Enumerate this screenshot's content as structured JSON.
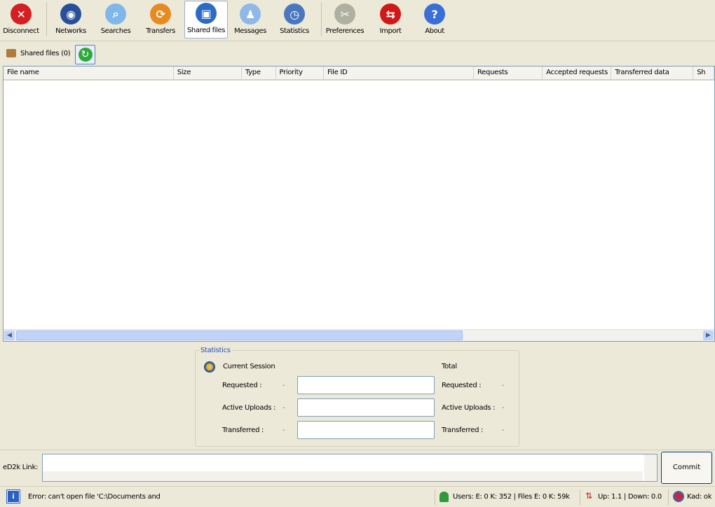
{
  "toolbar": [
    {
      "label": "Disconnect",
      "icon": "disconnect-icon"
    },
    {
      "label": "Networks",
      "icon": "networks-icon"
    },
    {
      "label": "Searches",
      "icon": "searches-icon"
    },
    {
      "label": "Transfers",
      "icon": "transfers-icon"
    },
    {
      "label": "Shared files",
      "icon": "shared-files-icon"
    },
    {
      "label": "Messages",
      "icon": "messages-icon"
    },
    {
      "label": "Statistics",
      "icon": "statistics-icon"
    },
    {
      "label": "Preferences",
      "icon": "preferences-icon"
    },
    {
      "label": "Import",
      "icon": "import-icon"
    },
    {
      "label": "About",
      "icon": "about-icon"
    }
  ],
  "shared_label": "Shared files (0)",
  "columns": [
    "File name",
    "Size",
    "Type",
    "Priority",
    "File ID",
    "Requests",
    "Accepted requests",
    "Transferred data",
    "Sh"
  ],
  "stats": {
    "title": "Statistics",
    "current": "Current Session",
    "total": "Total",
    "rows": [
      {
        "label": "Requested :",
        "value": "-",
        "total_label": "Requested :",
        "total_value": "-"
      },
      {
        "label": "Active Uploads :",
        "value": "-",
        "total_label": "Active Uploads :",
        "total_value": "-"
      },
      {
        "label": "Transferred :",
        "value": "-",
        "total_label": "Transferred :",
        "total_value": "-"
      }
    ]
  },
  "ed2k": {
    "label": "eD2k Link:",
    "value": "",
    "commit": "Commit"
  },
  "status": {
    "message": "Error: can't open file 'C:\\Documents and",
    "users": "Users: E: 0 K: 352 | Files E: 0 K: 59k",
    "rate": "Up: 1.1 | Down: 0.0",
    "kad": "Kad: ok"
  }
}
